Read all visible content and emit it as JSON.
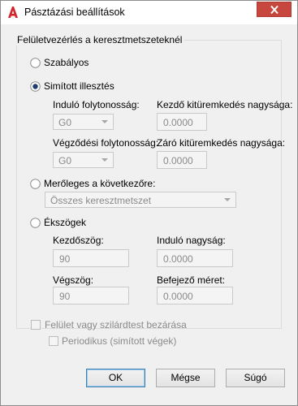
{
  "window": {
    "title": "Pásztázási beállítások"
  },
  "group": {
    "title": "Felületvezérlés a keresztmetszeteknél"
  },
  "options": {
    "regular": {
      "label": "Szabályos",
      "selected": false
    },
    "smooth_fit": {
      "label": "Simított illesztés",
      "selected": true
    },
    "perpendicular": {
      "label": "Merőleges a következőre:",
      "selected": false
    },
    "draft_angles": {
      "label": "Ékszögek",
      "selected": false
    }
  },
  "smooth_fit": {
    "start_continuity_label": "Induló folytonosság:",
    "start_continuity_value": "G0",
    "start_bulge_label": "Kezdő kitüremkedés nagysága:",
    "start_bulge_value": "0.0000",
    "end_continuity_label": "Végződési folytonosság:",
    "end_continuity_value": "G0",
    "end_bulge_label": "Záró kitüremkedés nagysága:",
    "end_bulge_value": "0.0000"
  },
  "perpendicular": {
    "select_value": "Összes keresztmetszet"
  },
  "draft": {
    "start_angle_label": "Kezdőszög:",
    "start_angle_value": "90",
    "start_magnitude_label": "Induló nagyság:",
    "start_magnitude_value": "0.0000",
    "end_angle_label": "Végszög:",
    "end_angle_value": "90",
    "end_magnitude_label": "Befejező méret:",
    "end_magnitude_value": "0.0000"
  },
  "close_surface": {
    "label": "Felület vagy szilárdtest bezárása",
    "checked": false
  },
  "periodic": {
    "label": "Periodikus (simított végek)",
    "checked": false
  },
  "buttons": {
    "ok": "OK",
    "cancel": "Mégse",
    "help": "Súgó"
  },
  "colors": {
    "close_button": "#c7463d",
    "accent": "#3c7fb1",
    "logo": "#d6252a"
  }
}
